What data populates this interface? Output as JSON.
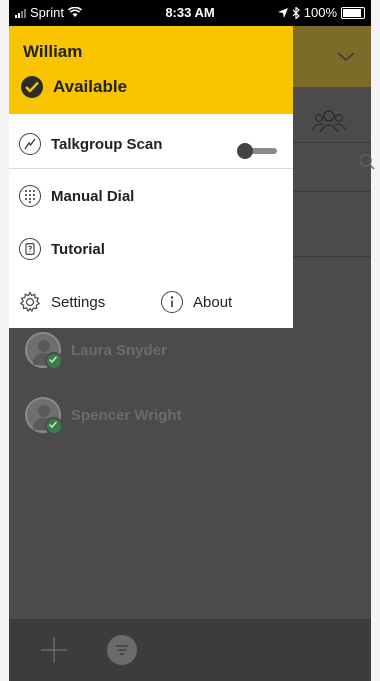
{
  "status_bar": {
    "carrier": "Sprint",
    "time": "8:33 AM",
    "battery": "100%"
  },
  "drawer": {
    "user_name": "William",
    "status": "Available",
    "items": [
      {
        "label": "Talkgroup Scan",
        "icon": "talkgroup-scan-icon"
      },
      {
        "label": "Manual Dial",
        "icon": "dialpad-icon"
      },
      {
        "label": "Tutorial",
        "icon": "tutorial-icon"
      }
    ],
    "settings_label": "Settings",
    "about_label": "About",
    "talkgroup_scan_enabled": false
  },
  "contacts": [
    {
      "name": "Laura Snyder",
      "status": "available"
    },
    {
      "name": "Spencer Wright",
      "status": "available"
    }
  ],
  "colors": {
    "accent": "#f8c400",
    "overlay": "#4b4b4b",
    "available": "#3a7d4a"
  }
}
